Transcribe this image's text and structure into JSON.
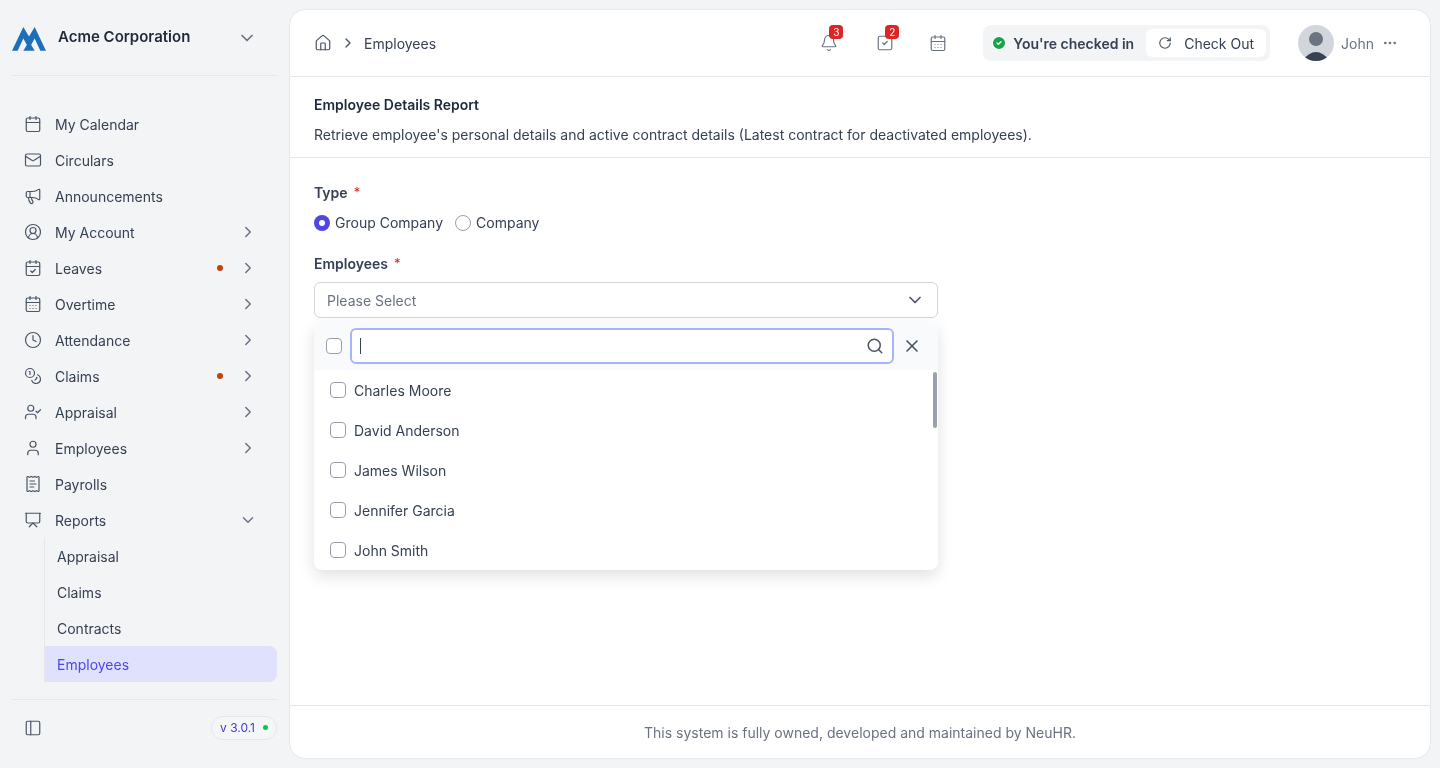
{
  "org": {
    "name": "Acme Corporation"
  },
  "sidebar": {
    "items": [
      {
        "label": "My Calendar",
        "dot": false
      },
      {
        "label": "Circulars",
        "dot": false
      },
      {
        "label": "Announcements",
        "dot": false
      },
      {
        "label": "My Account",
        "dot": false,
        "expanded": false
      },
      {
        "label": "Leaves",
        "dot": true,
        "expanded": false
      },
      {
        "label": "Overtime",
        "dot": false,
        "expanded": false
      },
      {
        "label": "Attendance",
        "dot": false,
        "expanded": false
      },
      {
        "label": "Claims",
        "dot": true,
        "expanded": false
      },
      {
        "label": "Appraisal",
        "dot": false,
        "expanded": false
      },
      {
        "label": "Employees",
        "dot": false,
        "expanded": false
      },
      {
        "label": "Payrolls",
        "dot": false
      },
      {
        "label": "Reports",
        "dot": false,
        "expanded": true,
        "children": [
          {
            "label": "Appraisal",
            "selected": false
          },
          {
            "label": "Claims",
            "selected": false
          },
          {
            "label": "Contracts",
            "selected": false
          },
          {
            "label": "Employees",
            "selected": true
          }
        ]
      }
    ],
    "version": "v 3.0.1"
  },
  "topbar": {
    "breadcrumb": [
      "Employees"
    ],
    "notifications": "3",
    "tasks": "2",
    "checked_in": true,
    "status": "You're checked in",
    "check_out": "Check Out",
    "user": "John"
  },
  "report": {
    "title": "Employee Details Report",
    "description": "Retrieve employee's personal details and active contract details (Latest contract for deactivated employees)."
  },
  "form": {
    "type_label": "Type",
    "type_required": "*",
    "types": [
      {
        "label": "Group Company",
        "selected": true
      },
      {
        "label": "Company",
        "selected": false
      }
    ],
    "employees_label": "Employees",
    "employees_required": "*",
    "employees_placeholder": "Please Select",
    "select_all": {
      "checked": false
    },
    "options": [
      {
        "label": "Charles Moore",
        "checked": false
      },
      {
        "label": "David Anderson",
        "checked": false
      },
      {
        "label": "James Wilson",
        "checked": false
      },
      {
        "label": "Jennifer Garcia",
        "checked": false
      },
      {
        "label": "John Smith",
        "checked": false
      }
    ]
  },
  "footer": "This system is fully owned, developed and maintained by NeuHR."
}
